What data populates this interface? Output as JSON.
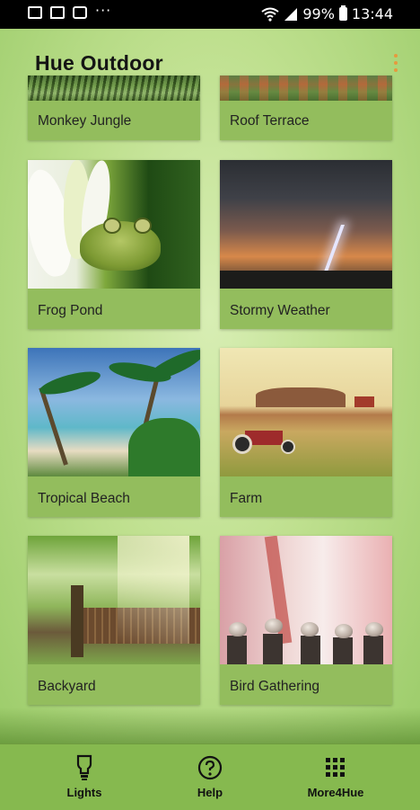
{
  "status_bar": {
    "battery": "99%",
    "time": "13:44",
    "left_icons": [
      "gallery-icon",
      "cast-icon",
      "tv-icon",
      "more-icon"
    ],
    "right_icons": [
      "wifi-icon",
      "signal-icon",
      "battery-icon"
    ]
  },
  "header": {
    "title": "Hue Outdoor"
  },
  "scenes": [
    {
      "label": "Monkey Jungle"
    },
    {
      "label": "Roof Terrace"
    },
    {
      "label": "Frog Pond"
    },
    {
      "label": "Stormy Weather"
    },
    {
      "label": "Tropical Beach"
    },
    {
      "label": "Farm"
    },
    {
      "label": "Backyard"
    },
    {
      "label": "Bird Gathering"
    }
  ],
  "bottom_nav": {
    "items": [
      {
        "label": "Lights",
        "icon": "bulb-icon"
      },
      {
        "label": "Help",
        "icon": "help-icon"
      },
      {
        "label": "More4Hue",
        "icon": "grid-icon"
      }
    ]
  },
  "colors": {
    "accent": "#e59a3e",
    "nav_background": "#86b94f",
    "card_background": "#93bd5d"
  }
}
